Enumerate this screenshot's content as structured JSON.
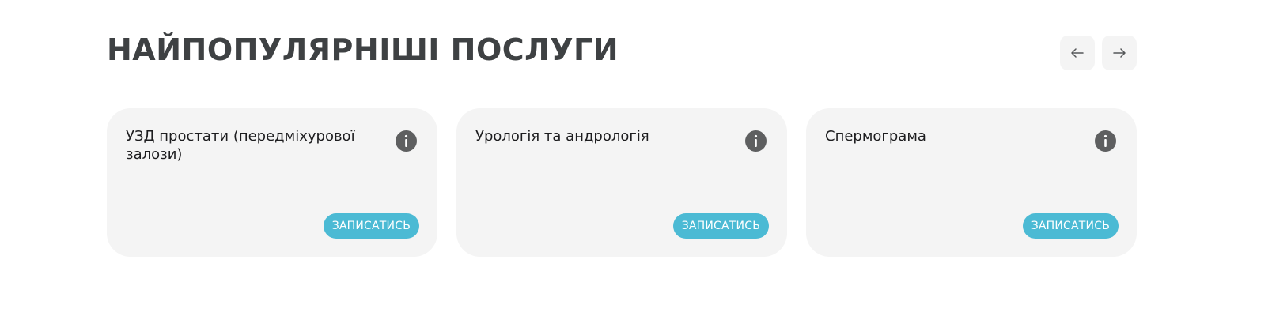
{
  "section": {
    "title": "НАЙПОПУЛЯРНІШІ ПОСЛУГИ",
    "nav": {
      "prev_icon": "arrow-left-icon",
      "next_icon": "arrow-right-icon"
    }
  },
  "cards": [
    {
      "title": "УЗД простати (передміхурової залози)",
      "info_icon": "info-icon",
      "button_label": "ЗАПИСАТИСЬ"
    },
    {
      "title": "Урологія та андрологія",
      "info_icon": "info-icon",
      "button_label": "ЗАПИСАТИСЬ"
    },
    {
      "title": "Спермограма",
      "info_icon": "info-icon",
      "button_label": "ЗАПИСАТИСЬ"
    }
  ],
  "colors": {
    "title": "#3e4143",
    "card_background": "#f4f4f4",
    "accent_button": "#4bbad4",
    "info_icon": "#5e5f60"
  }
}
